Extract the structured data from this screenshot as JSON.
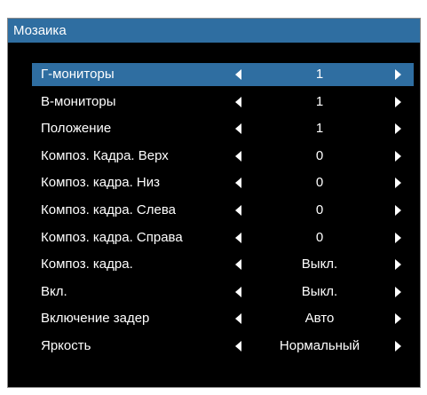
{
  "window": {
    "title": "Мозаика"
  },
  "colors": {
    "accent": "#2f6ea1",
    "background": "#000000",
    "text": "#ffffff"
  },
  "menu": {
    "selected_index": 0,
    "items": [
      {
        "label": "Г-мониторы",
        "value": "1"
      },
      {
        "label": "В-мониторы",
        "value": "1"
      },
      {
        "label": "Положение",
        "value": "1"
      },
      {
        "label": "Композ. Кадра. Верх",
        "value": "0"
      },
      {
        "label": "Композ. кадра. Низ",
        "value": "0"
      },
      {
        "label": "Композ. кадра. Слева",
        "value": "0"
      },
      {
        "label": "Композ. кадра. Справа",
        "value": "0"
      },
      {
        "label": "Композ. кадра.",
        "value": "Выкл."
      },
      {
        "label": "Вкл.",
        "value": "Выкл."
      },
      {
        "label": "Включение задер",
        "value": "Авто"
      },
      {
        "label": "Яркость",
        "value": "Нормальный"
      }
    ]
  },
  "icons": {
    "decrease": "triangle-left-icon",
    "increase": "triangle-right-icon"
  }
}
